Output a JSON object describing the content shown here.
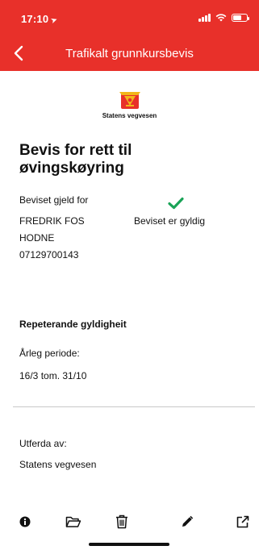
{
  "status_bar": {
    "time": "17:10"
  },
  "nav": {
    "title": "Trafikalt grunnkursbevis"
  },
  "logo": {
    "text": "Statens vegvesen"
  },
  "certificate": {
    "title": "Bevis for rett til øvingskøyring",
    "valid_for_label": "Beviset gjeld for",
    "name_line1": "FREDRIK FOS",
    "name_line2": "HODNE",
    "id_number": "07129700143",
    "status": "Beviset er gyldig",
    "status_color": "#1aa357"
  },
  "validity": {
    "heading": "Repeterande gyldigheit",
    "period_label": "Årleg periode:",
    "period_value": "16/3 tom. 31/10"
  },
  "issuer": {
    "label": "Utferda av:",
    "value": "Statens vegvesen"
  },
  "toolbar": {
    "icons": [
      "info-icon",
      "folder-icon",
      "trash-icon",
      "pencil-icon",
      "share-icon"
    ]
  },
  "colors": {
    "brand": "#e8302a"
  }
}
